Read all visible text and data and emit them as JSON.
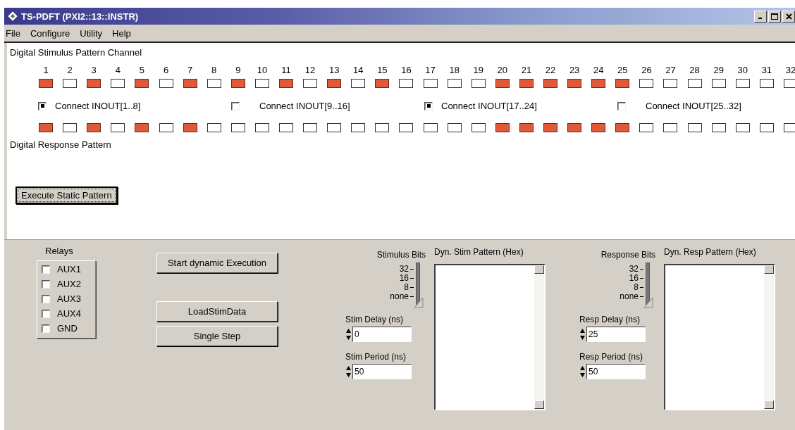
{
  "window": {
    "title": "TS-PDFT (PXI2::13::INSTR)"
  },
  "menu": [
    {
      "label": "File"
    },
    {
      "label": "Configure"
    },
    {
      "label": "Utility"
    },
    {
      "label": "Help"
    }
  ],
  "stimulus": {
    "label": "Digital Stimulus Pattern Channel",
    "channels": [
      {
        "number": "1",
        "on": true
      },
      {
        "number": "2",
        "on": false
      },
      {
        "number": "3",
        "on": true
      },
      {
        "number": "4",
        "on": false
      },
      {
        "number": "5",
        "on": true
      },
      {
        "number": "6",
        "on": false
      },
      {
        "number": "7",
        "on": true
      },
      {
        "number": "8",
        "on": false
      },
      {
        "number": "9",
        "on": true
      },
      {
        "number": "10",
        "on": false
      },
      {
        "number": "11",
        "on": true
      },
      {
        "number": "12",
        "on": false
      },
      {
        "number": "13",
        "on": true
      },
      {
        "number": "14",
        "on": false
      },
      {
        "number": "15",
        "on": true
      },
      {
        "number": "16",
        "on": false
      },
      {
        "number": "17",
        "on": false
      },
      {
        "number": "18",
        "on": false
      },
      {
        "number": "19",
        "on": false
      },
      {
        "number": "20",
        "on": true
      },
      {
        "number": "21",
        "on": true
      },
      {
        "number": "22",
        "on": true
      },
      {
        "number": "23",
        "on": true
      },
      {
        "number": "24",
        "on": true
      },
      {
        "number": "25",
        "on": true
      },
      {
        "number": "26",
        "on": false
      },
      {
        "number": "27",
        "on": false
      },
      {
        "number": "28",
        "on": false
      },
      {
        "number": "29",
        "on": false
      },
      {
        "number": "30",
        "on": false
      },
      {
        "number": "31",
        "on": false
      },
      {
        "number": "32",
        "on": false
      }
    ]
  },
  "connects": [
    {
      "label": "Connect INOUT[1..8]",
      "checked": true
    },
    {
      "label": "Connect INOUT[9..16]",
      "checked": false
    },
    {
      "label": "Connect INOUT[17..24]",
      "checked": true
    },
    {
      "label": "Connect INOUT[25..32]",
      "checked": false
    }
  ],
  "response": {
    "label": "Digital Response Pattern",
    "channels": [
      {
        "on": true
      },
      {
        "on": false
      },
      {
        "on": true
      },
      {
        "on": false
      },
      {
        "on": true
      },
      {
        "on": false
      },
      {
        "on": true
      },
      {
        "on": false
      },
      {
        "on": false
      },
      {
        "on": false
      },
      {
        "on": false
      },
      {
        "on": false
      },
      {
        "on": false
      },
      {
        "on": false
      },
      {
        "on": false
      },
      {
        "on": false
      },
      {
        "on": false
      },
      {
        "on": false
      },
      {
        "on": false
      },
      {
        "on": true
      },
      {
        "on": true
      },
      {
        "on": true
      },
      {
        "on": true
      },
      {
        "on": true
      },
      {
        "on": true
      },
      {
        "on": false
      },
      {
        "on": false
      },
      {
        "on": false
      },
      {
        "on": false
      },
      {
        "on": false
      },
      {
        "on": false
      },
      {
        "on": false
      }
    ]
  },
  "execute_button": "Execute Static Pattern",
  "relays": {
    "label": "Relays",
    "items": [
      {
        "label": "AUX1",
        "checked": false
      },
      {
        "label": "AUX2",
        "checked": false
      },
      {
        "label": "AUX3",
        "checked": false
      },
      {
        "label": "AUX4",
        "checked": false
      },
      {
        "label": "GND",
        "checked": false
      }
    ]
  },
  "buttons": [
    "Start dynamic Execution",
    "LoadStimData",
    "Single Step"
  ],
  "dynamic": [
    {
      "bits_label": "Stimulus Bits",
      "ticks": [
        "32",
        "16",
        "8",
        "none"
      ],
      "level": 0,
      "pattern_label": "Dyn. Stim Pattern (Hex)",
      "delay_label": "Stim Delay (ns)",
      "delay_value": "0",
      "period_label": "Stim Period (ns)",
      "period_value": "50"
    },
    {
      "bits_label": "Response Bits",
      "ticks": [
        "32",
        "16",
        "8",
        "none"
      ],
      "level": 0,
      "pattern_label": "Dyn. Resp Pattern (Hex)",
      "delay_label": "Resp Delay (ns)",
      "delay_value": "25",
      "period_label": "Resp Period (ns)",
      "period_value": "50"
    }
  ]
}
